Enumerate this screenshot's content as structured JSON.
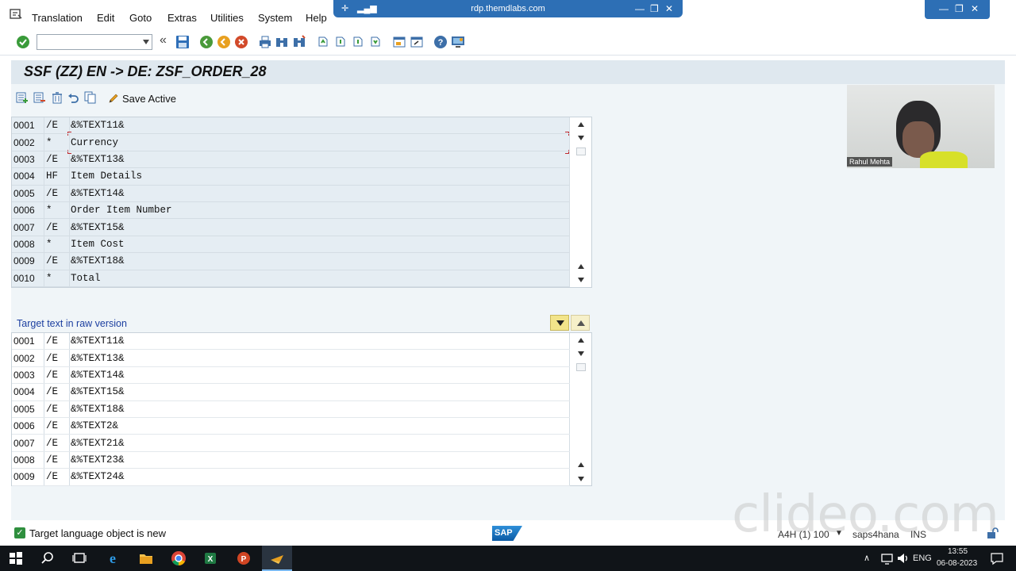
{
  "menu": {
    "items": [
      "Translation",
      "Edit",
      "Goto",
      "Extras",
      "Utilities",
      "System",
      "Help"
    ]
  },
  "rdp": {
    "host": "rdp.themdlabs.com"
  },
  "toolbar": {
    "command_value": ""
  },
  "title": "SSF (ZZ) EN -> DE: ZSF_ORDER_28",
  "app_toolbar": {
    "save_active": "Save Active"
  },
  "source_rows": [
    {
      "num": "0001",
      "fmt": "/E",
      "text": "&%TEXT11&"
    },
    {
      "num": "0002",
      "fmt": "*",
      "text": "Currency"
    },
    {
      "num": "0003",
      "fmt": "/E",
      "text": "&%TEXT13&"
    },
    {
      "num": "0004",
      "fmt": "HF",
      "text": "Item Details"
    },
    {
      "num": "0005",
      "fmt": "/E",
      "text": "&%TEXT14&"
    },
    {
      "num": "0006",
      "fmt": "*",
      "text": "Order Item Number"
    },
    {
      "num": "0007",
      "fmt": "/E",
      "text": "&%TEXT15&"
    },
    {
      "num": "0008",
      "fmt": "*",
      "text": "Item Cost"
    },
    {
      "num": "0009",
      "fmt": "/E",
      "text": "&%TEXT18&"
    },
    {
      "num": "0010",
      "fmt": "*",
      "text": "Total"
    }
  ],
  "target_label": "Target text in raw version",
  "target_rows": [
    {
      "num": "0001",
      "fmt": "/E",
      "text": "&%TEXT11&"
    },
    {
      "num": "0002",
      "fmt": "/E",
      "text": "&%TEXT13&"
    },
    {
      "num": "0003",
      "fmt": "/E",
      "text": "&%TEXT14&"
    },
    {
      "num": "0004",
      "fmt": "/E",
      "text": "&%TEXT15&"
    },
    {
      "num": "0005",
      "fmt": "/E",
      "text": "&%TEXT18&"
    },
    {
      "num": "0006",
      "fmt": "/E",
      "text": "&%TEXT2&"
    },
    {
      "num": "0007",
      "fmt": "/E",
      "text": "&%TEXT21&"
    },
    {
      "num": "0008",
      "fmt": "/E",
      "text": "&%TEXT23&"
    },
    {
      "num": "0009",
      "fmt": "/E",
      "text": "&%TEXT24&"
    }
  ],
  "video": {
    "name": "Rahul Mehta"
  },
  "status": {
    "message": "Target language object is new",
    "system": "A4H (1) 100",
    "host": "saps4hana",
    "mode": "INS"
  },
  "watermark": "clideo.com",
  "sap_logo": "SAP",
  "taskbar": {
    "lang": "ENG",
    "time": "13:55",
    "date": "06-08-2023"
  },
  "colors": {
    "title_bg": "#dfe8ef",
    "source_bg": "#e5edf3",
    "label_blue": "#1c3fa0",
    "taskbar": "#101418",
    "rdp_blue": "#2d6fb5"
  }
}
